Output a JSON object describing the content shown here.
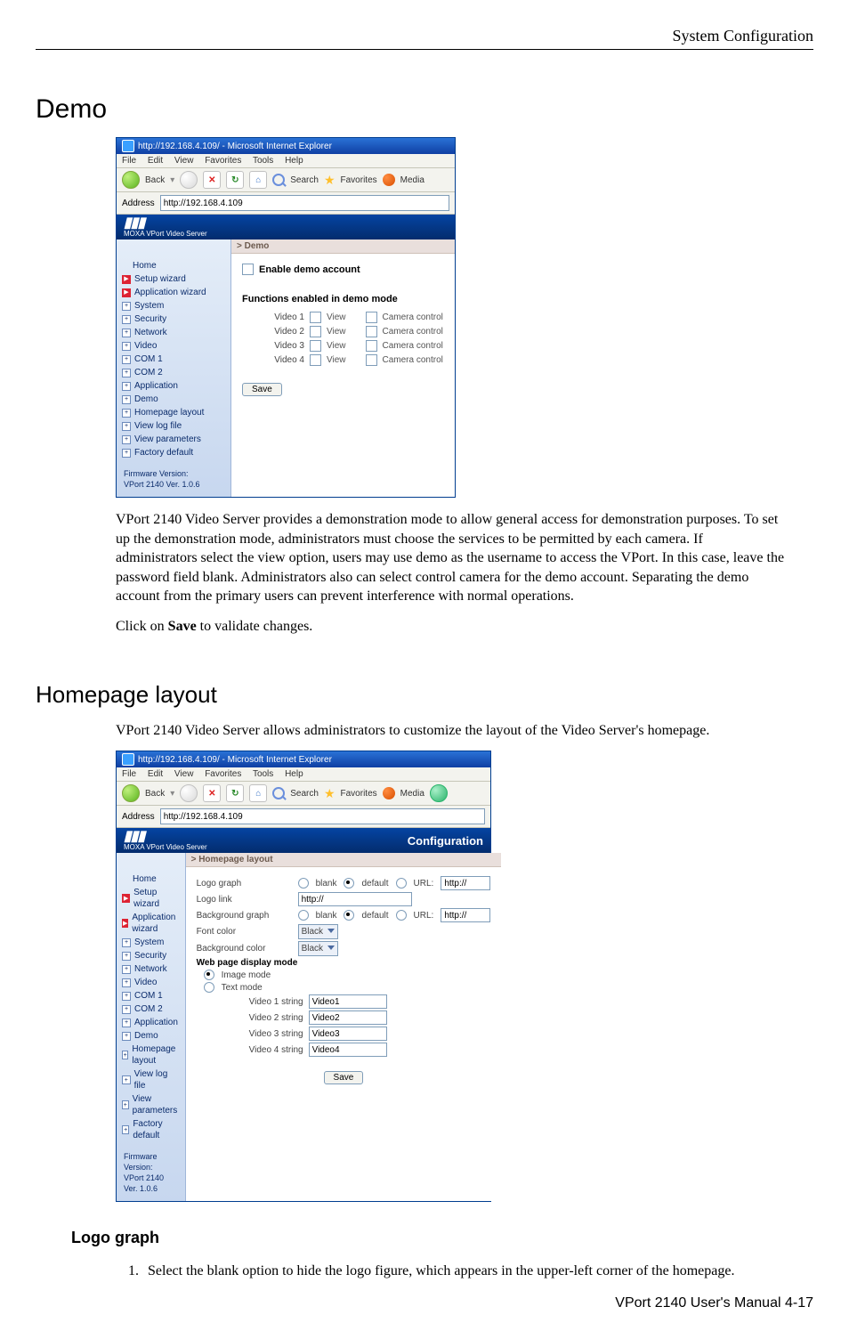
{
  "header": {
    "title": "System Configuration"
  },
  "footer": {
    "text": "VPort 2140 User's Manual 4-17"
  },
  "sections": {
    "demo": {
      "heading": "Demo",
      "para": "VPort 2140 Video Server provides a demonstration mode to allow general access for demonstration purposes. To set up the demonstration mode, administrators must choose the services to be permitted by each camera. If administrators select the view option, users may use demo as the username to access the VPort. In this case, leave the password field blank. Administrators also can select control camera for the demo account. Separating the demo account from the primary users can prevent interference with normal operations.",
      "save_word": "Save",
      "save_rest": "to validate changes."
    },
    "homepage": {
      "heading": "Homepage layout",
      "para": "VPort 2140 Video Server allows administrators to customize the layout of the Video Server's homepage."
    },
    "logograph": {
      "heading": "Logo graph",
      "items": [
        "Select the blank option to hide the logo figure, which appears in the upper-left corner of the homepage."
      ]
    }
  },
  "shot1": {
    "ie": {
      "title": "http://192.168.4.109/ - Microsoft Internet Explorer",
      "menu": [
        "File",
        "Edit",
        "View",
        "Favorites",
        "Tools",
        "Help"
      ],
      "toolbar": {
        "back": "Back",
        "search": "Search",
        "favorites": "Favorites",
        "media": "Media"
      },
      "address_label": "Address",
      "address": "http://192.168.4.109"
    },
    "brandbar": {
      "sub": "MOXA VPort Video Server"
    },
    "nav": [
      "Home",
      "Setup wizard",
      "Application wizard",
      "System",
      "Security",
      "Network",
      "Video",
      "COM 1",
      "COM 2",
      "Application",
      "Demo",
      "Homepage layout",
      "View log file",
      "View parameters",
      "Factory default"
    ],
    "firmware": {
      "label": "Firmware Version:",
      "value": "VPort 2140 Ver. 1.0.6"
    },
    "panel": {
      "breadcrumb": "> Demo",
      "enable": "Enable demo account",
      "func_heading": "Functions enabled in demo mode",
      "view": "View",
      "cam": "Camera control",
      "rows": [
        {
          "label": "Video 1"
        },
        {
          "label": "Video 2"
        },
        {
          "label": "Video 3"
        },
        {
          "label": "Video 4"
        }
      ],
      "save": "Save"
    }
  },
  "shot2": {
    "ie": {
      "title": "http://192.168.4.109/ - Microsoft Internet Explorer",
      "menu": [
        "File",
        "Edit",
        "View",
        "Favorites",
        "Tools",
        "Help"
      ],
      "toolbar": {
        "back": "Back",
        "search": "Search",
        "favorites": "Favorites",
        "media": "Media"
      },
      "address_label": "Address",
      "address": "http://192.168.4.109"
    },
    "brandbar": {
      "sub": "MOXA VPort Video Server",
      "right": "Configuration"
    },
    "nav": [
      "Home",
      "Setup wizard",
      "Application wizard",
      "System",
      "Security",
      "Network",
      "Video",
      "COM 1",
      "COM 2",
      "Application",
      "Demo",
      "Homepage layout",
      "View log file",
      "View parameters",
      "Factory default"
    ],
    "firmware": {
      "label": "Firmware Version:",
      "value": "VPort 2140 Ver. 1.0.6"
    },
    "panel": {
      "breadcrumb": "> Homepage layout",
      "opt_blank": "blank",
      "opt_default": "default",
      "opt_url": "URL:",
      "rows": [
        {
          "label": "Logo graph",
          "url": "http://"
        },
        {
          "label": "Logo link",
          "value": "http://"
        },
        {
          "label": "Background graph",
          "url": "http://"
        },
        {
          "label": "Font color",
          "value": "Black"
        },
        {
          "label": "Background color",
          "value": "Black"
        }
      ],
      "displaymode": "Web page display mode",
      "mode_image": "Image mode",
      "mode_text": "Text mode",
      "vs": [
        {
          "label": "Video 1 string",
          "value": "Video1"
        },
        {
          "label": "Video 2 string",
          "value": "Video2"
        },
        {
          "label": "Video 3 string",
          "value": "Video3"
        },
        {
          "label": "Video 4 string",
          "value": "Video4"
        }
      ],
      "save": "Save"
    }
  }
}
